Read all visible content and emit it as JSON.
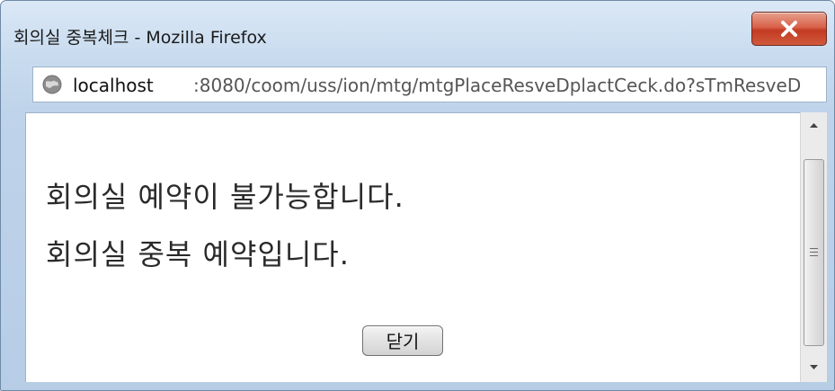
{
  "window": {
    "title": "회의실 중복체크 - Mozilla Firefox"
  },
  "urlbar": {
    "host": "localhost",
    "rest": ":8080/coom/uss/ion/mtg/mtgPlaceResveDplactCeck.do?sTmResveD"
  },
  "content": {
    "message_line1": "회의실 예약이 불가능합니다.",
    "message_line2": "회의실 중복 예약입니다.",
    "close_button_label": "닫기"
  },
  "icons": {
    "window_close": "close-icon",
    "site_identity": "globe-icon",
    "scroll_up": "arrow-up-icon",
    "scroll_down": "arrow-down-icon"
  },
  "colors": {
    "close_button": "#c33a22",
    "frame": "#c9dcef"
  }
}
